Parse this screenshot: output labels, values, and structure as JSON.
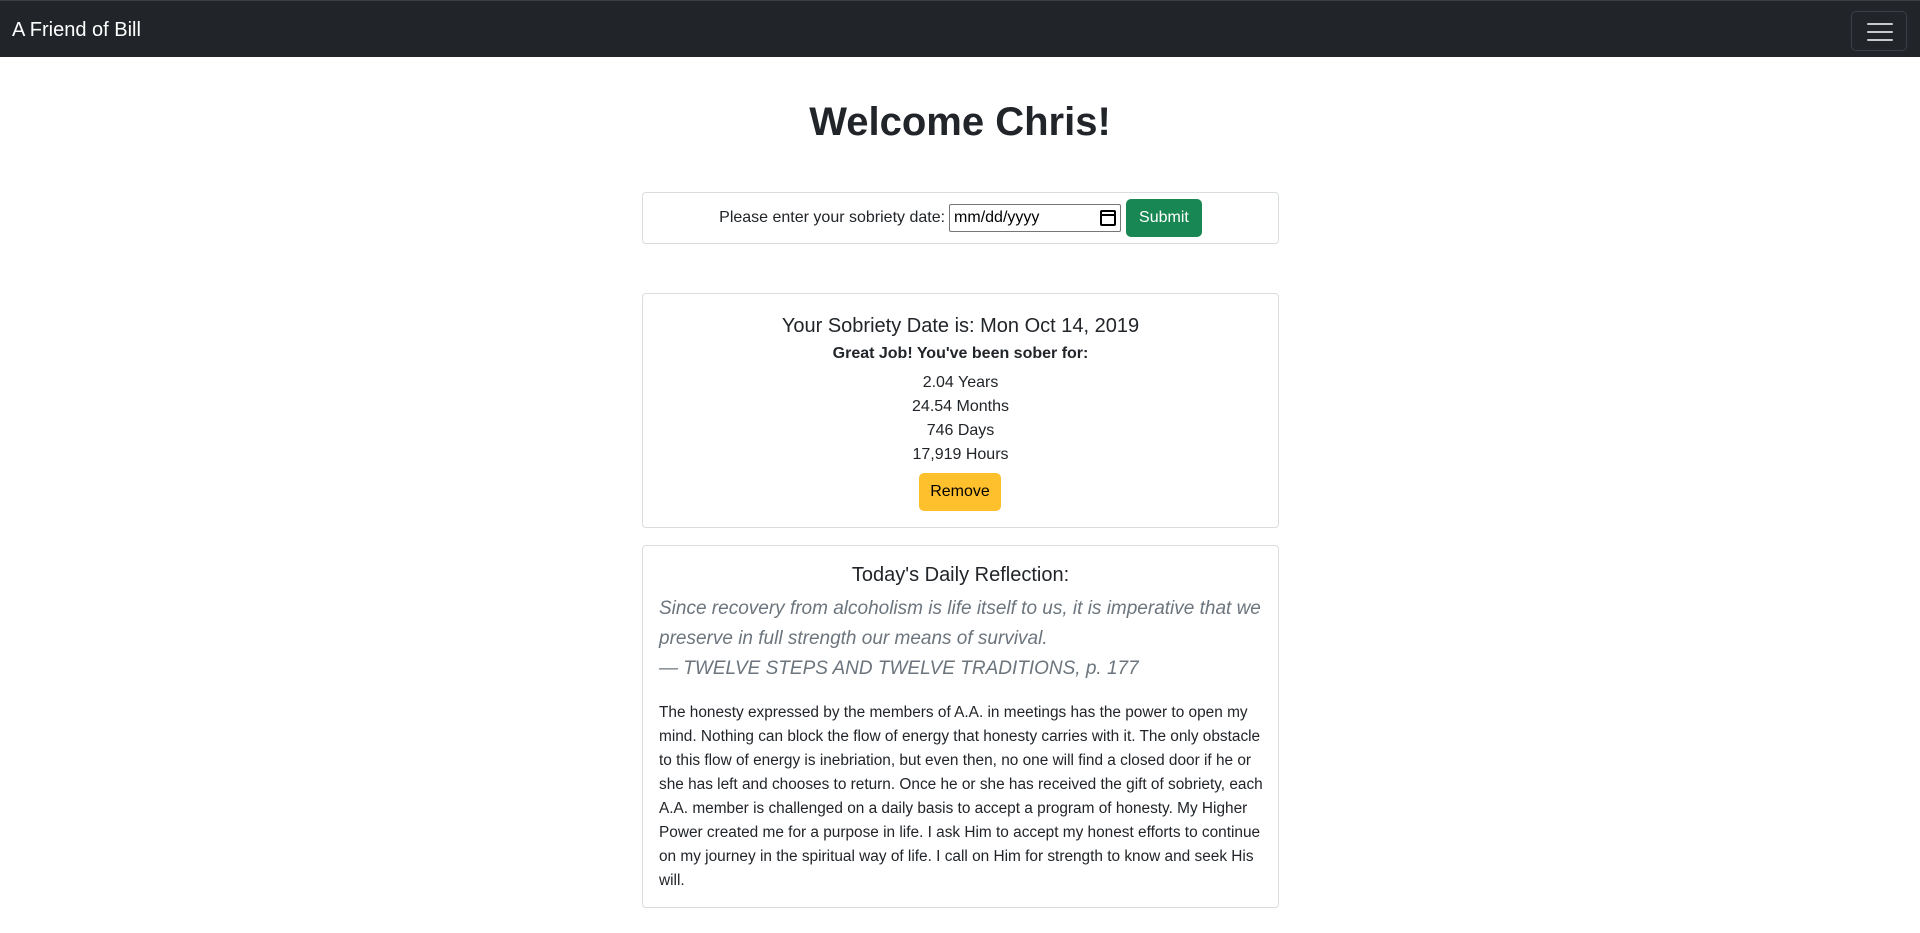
{
  "navbar": {
    "brand": "A Friend of Bill",
    "menu_icon": "hamburger-menu-icon"
  },
  "main": {
    "title": "Welcome Chris!"
  },
  "date_form": {
    "label": "Please enter your sobriety date:",
    "input_placeholder": "mm/dd/yyyy",
    "calendar_icon": "calendar-icon",
    "submit_label": "Submit"
  },
  "sobriety": {
    "heading": "Your Sobriety Date is: Mon Oct 14, 2019",
    "subheading": "Great Job! You've been sober for:",
    "stats": [
      "2.04 Years",
      "24.54 Months",
      "746 Days",
      "17,919 Hours"
    ],
    "remove_label": "Remove"
  },
  "reflection": {
    "heading": "Today's Daily Reflection:",
    "quote": "Since recovery from alcoholism is life itself to us, it is imperative that we preserve in full strength our means of survival.",
    "source": "— TWELVE STEPS AND TWELVE TRADITIONS, p. 177",
    "body": "The honesty expressed by the members of A.A. in meetings has the power to open my mind. Nothing can block the flow of energy that honesty carries with it. The only obstacle to this flow of energy is inebriation, but even then, no one will find a closed door if he or she has left and chooses to return. Once he or she has received the gift of sobriety, each A.A. member is challenged on a daily basis to accept a program of honesty. My Higher Power created me for a purpose in life. I ask Him to accept my honest efforts to continue on my journey in the spiritual way of life. I call on Him for strength to know and seek His will."
  },
  "colors": {
    "navbar_bg": "#212529",
    "submit_bg": "#198754",
    "remove_bg": "#ffc02d",
    "quote_text": "#6c757d"
  }
}
